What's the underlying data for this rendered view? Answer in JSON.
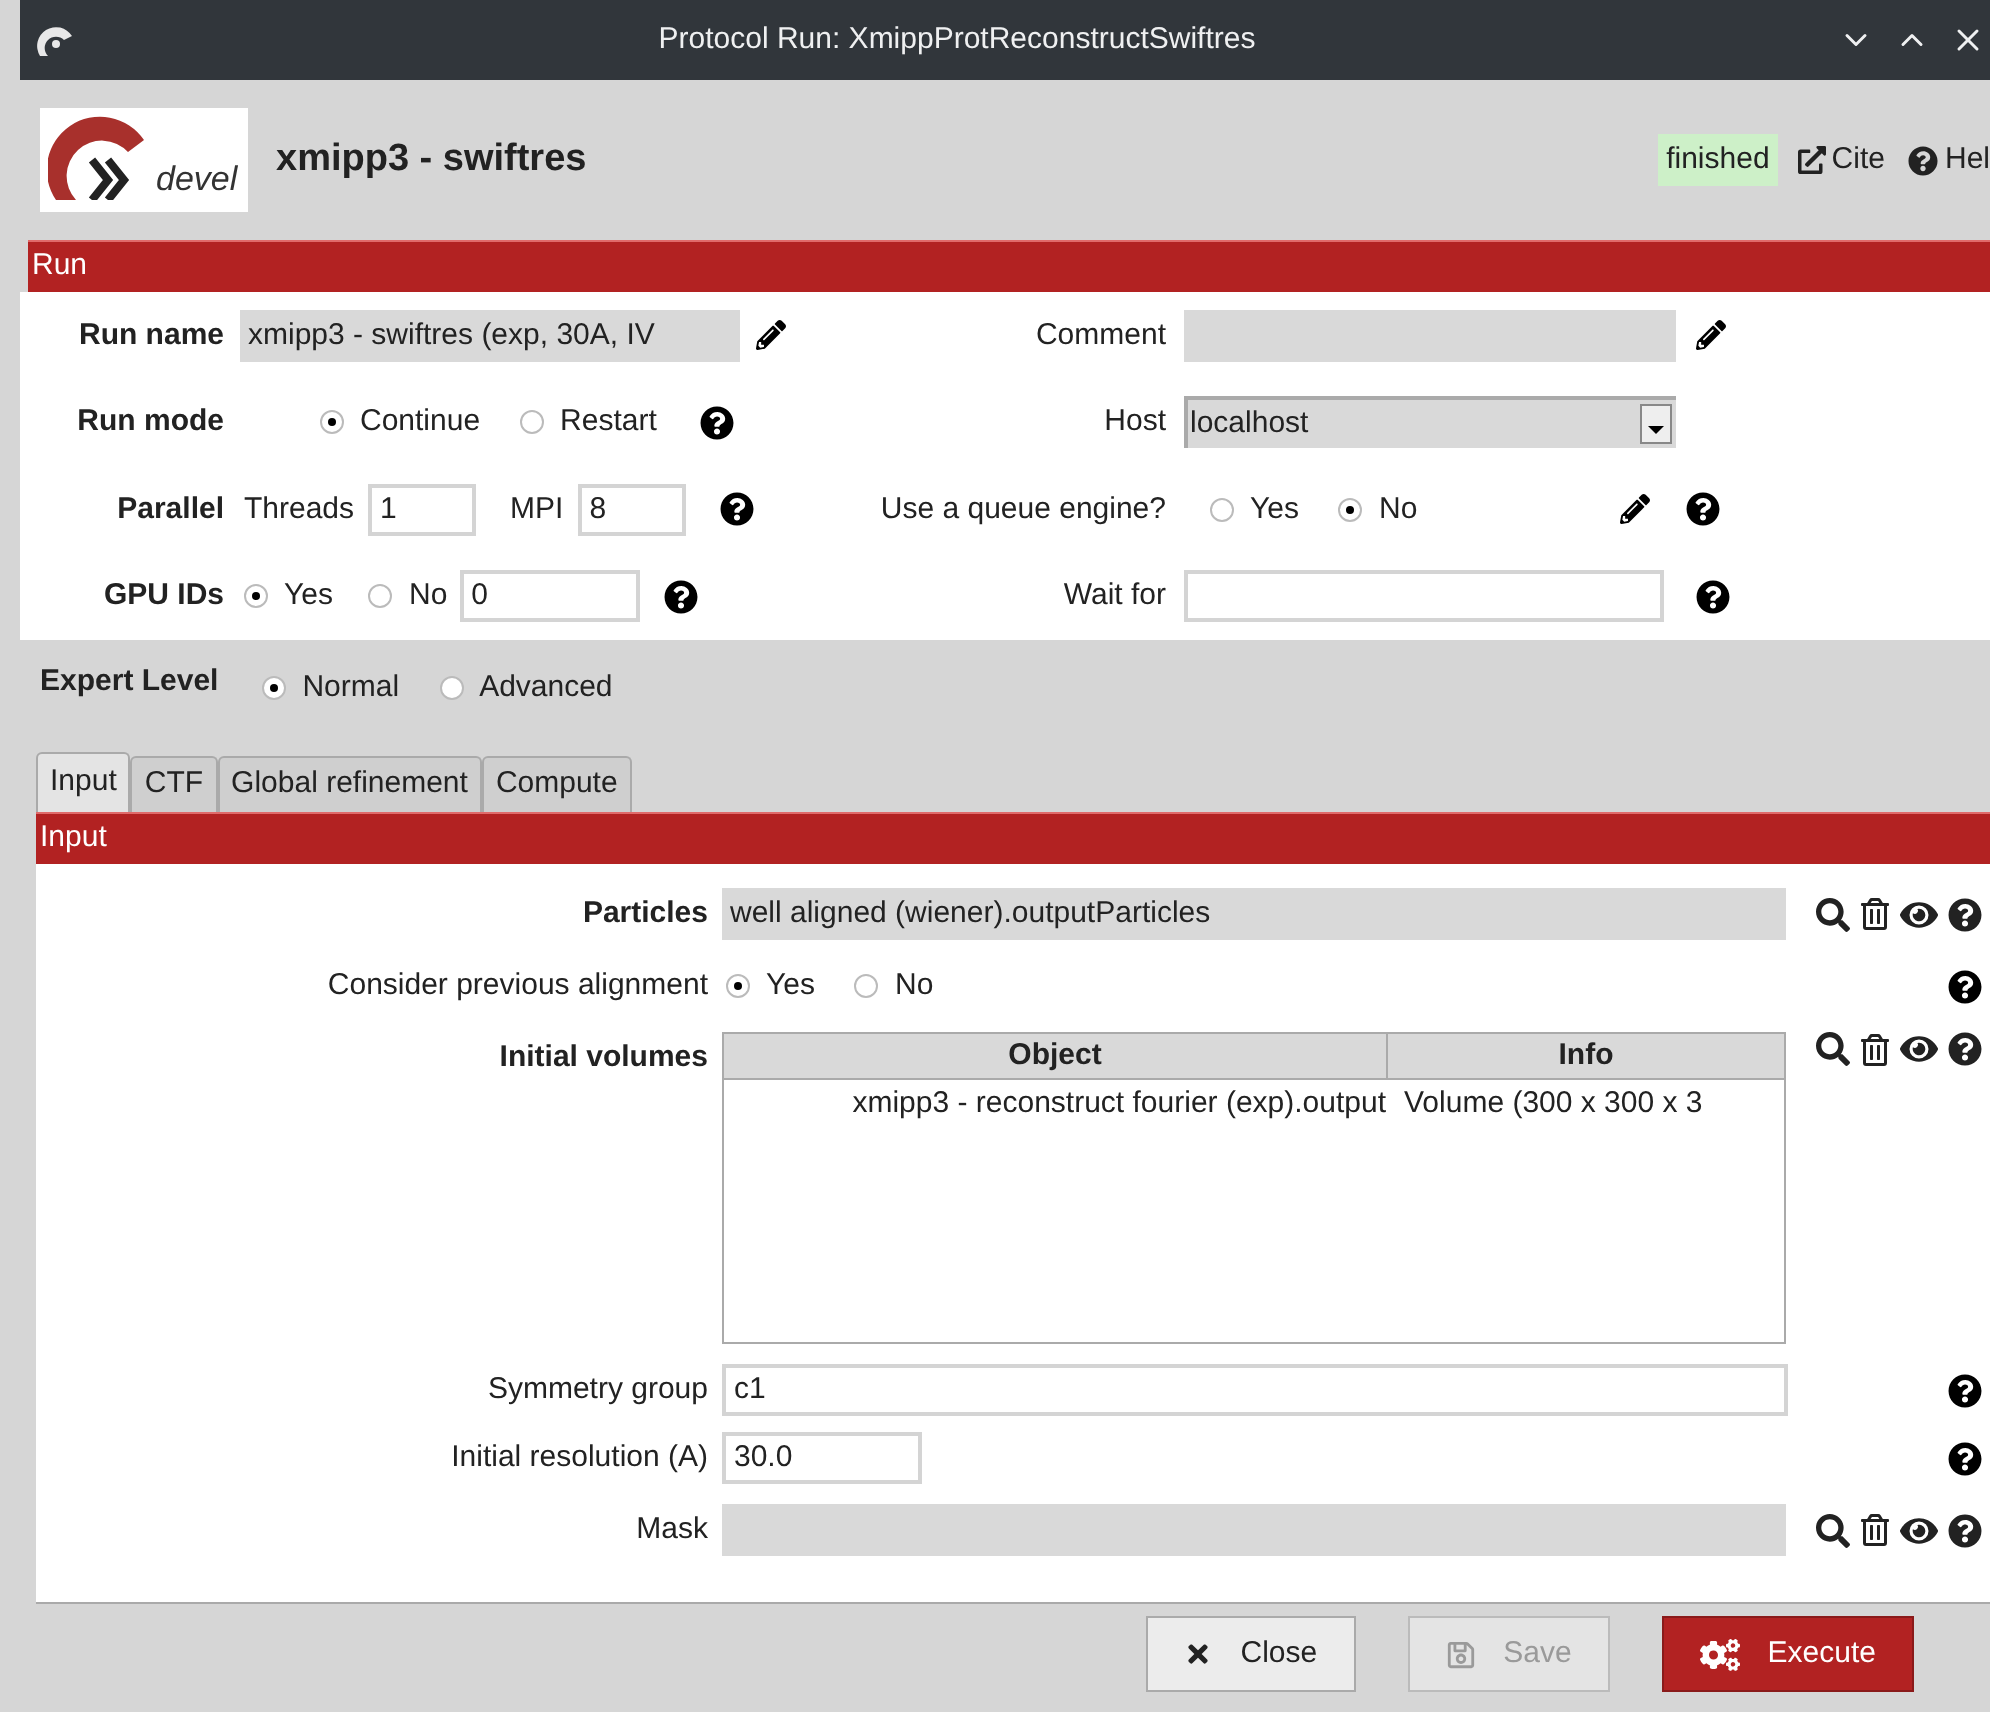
{
  "window": {
    "title": "Protocol Run: XmippProtReconstructSwiftres"
  },
  "header": {
    "logo_text": "devel",
    "program": "xmipp3 - swiftres",
    "status": "finished",
    "links": [
      "Cite",
      "Hel"
    ]
  },
  "run": {
    "title": "Run",
    "run_name": {
      "label": "Run name",
      "value": "xmipp3 - swiftres (exp, 30A, IV"
    },
    "comment": {
      "label": "Comment"
    },
    "run_mode": {
      "label": "Run mode",
      "options": [
        {
          "label": "Continue",
          "selected": true
        },
        {
          "label": "Restart",
          "selected": false
        }
      ]
    },
    "host": {
      "label": "Host",
      "value": "localhost"
    },
    "parallel": {
      "label": "Parallel",
      "threads_label": "Threads",
      "threads": "1",
      "mpi_label": "MPI",
      "mpi": "8"
    },
    "queue": {
      "label": "Use a queue engine?",
      "options": [
        {
          "label": "Yes",
          "selected": false
        },
        {
          "label": "No",
          "selected": true
        }
      ]
    },
    "gpu": {
      "label": "GPU IDs",
      "options": [
        {
          "label": "Yes",
          "selected": true
        },
        {
          "label": "No",
          "selected": false
        }
      ],
      "value": "0"
    },
    "wait_for": {
      "label": "Wait for"
    }
  },
  "expert_level": {
    "label": "Expert Level",
    "options": [
      {
        "label": "Normal",
        "selected": true
      },
      {
        "label": "Advanced",
        "selected": false
      }
    ]
  },
  "tabs": [
    {
      "label": "Input",
      "selected": true
    },
    {
      "label": "CTF",
      "selected": false
    },
    {
      "label": "Global refinement",
      "selected": false
    },
    {
      "label": "Compute",
      "selected": false
    }
  ],
  "input": {
    "title": "Input",
    "params": [
      {
        "kind": "pointer",
        "label": "Particles",
        "important": true,
        "value": "well aligned (wiener).outputParticles"
      },
      {
        "kind": "radio",
        "label": "Consider previous alignment",
        "important": false,
        "options": [
          {
            "label": "Yes",
            "selected": true
          },
          {
            "label": "No",
            "selected": false
          }
        ]
      },
      {
        "kind": "table",
        "label": "Initial volumes",
        "important": true,
        "columns": [
          "Object",
          "Info"
        ],
        "rows": [
          [
            "xmipp3 - reconstruct fourier (exp).output",
            "Volume (300 x 300 x 3"
          ]
        ]
      },
      {
        "kind": "text",
        "label": "Symmetry group",
        "important": false,
        "value": "c1"
      },
      {
        "kind": "short_text",
        "label": "Initial resolution (A)",
        "important": false,
        "value": "30.0"
      },
      {
        "kind": "pointer",
        "label": "Mask",
        "important": false
      }
    ]
  },
  "buttons": [
    {
      "label": "Close",
      "kind": "close",
      "disabled": false
    },
    {
      "label": "Save",
      "kind": "save",
      "disabled": true
    },
    {
      "label": "Execute",
      "kind": "execute",
      "disabled": false
    }
  ]
}
